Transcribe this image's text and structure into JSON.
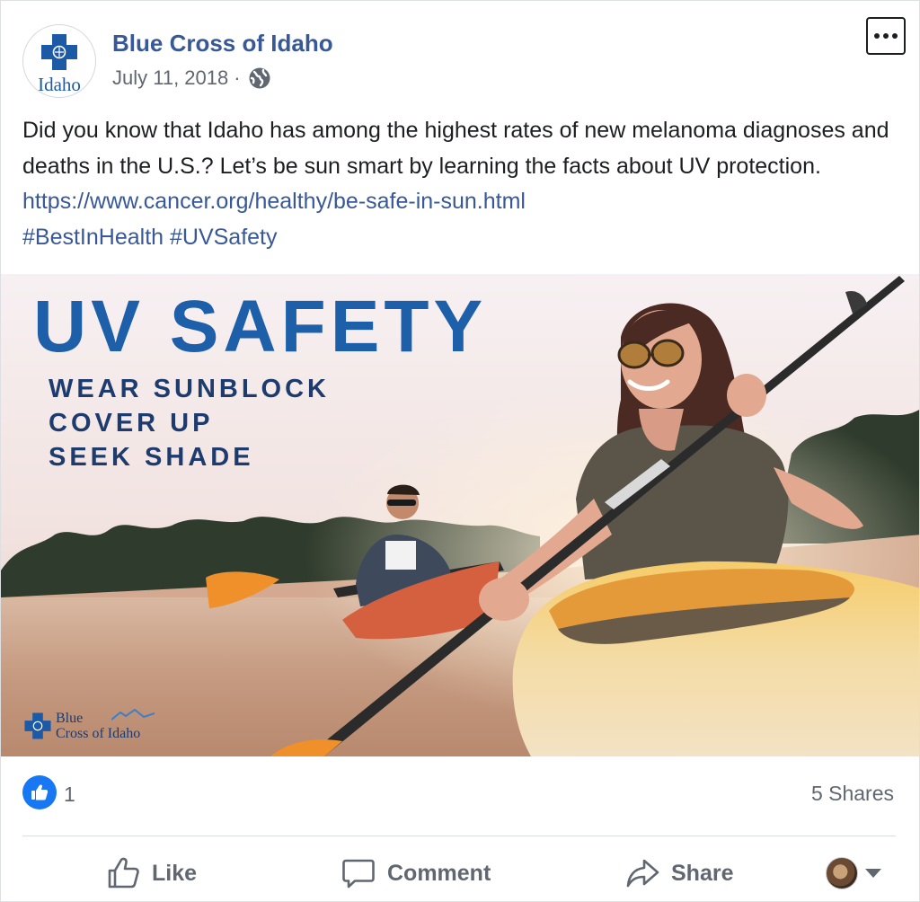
{
  "post": {
    "author": "Blue Cross of Idaho",
    "avatar_text": "Idaho",
    "date": "July 11, 2018",
    "separator": "·",
    "audience_icon": "globe-icon",
    "more_icon": "ellipsis-icon",
    "text": "Did you know that Idaho has among the highest rates of new melanoma diagnoses and deaths in the U.S.? Let’s be sun smart by learning the facts about UV protection.",
    "link": "https://www.cancer.org/healthy/be-safe-in-sun.html",
    "hashtags": [
      "#BestInHealth",
      "#UVSafety"
    ]
  },
  "image": {
    "title": "UV SAFETY",
    "lines": [
      "WEAR SUNBLOCK",
      "COVER UP",
      "SEEK SHADE"
    ],
    "logo_line1": "Blue",
    "logo_line2": "Cross of Idaho"
  },
  "stats": {
    "reaction_icon": "thumbs-up-icon",
    "reactions": "1",
    "shares": "5 Shares"
  },
  "actions": {
    "like": "Like",
    "comment": "Comment",
    "share": "Share"
  },
  "colors": {
    "link": "#385898",
    "brand_blue": "#1d5fa8",
    "reaction_blue": "#1877f2",
    "muted": "#606770"
  }
}
